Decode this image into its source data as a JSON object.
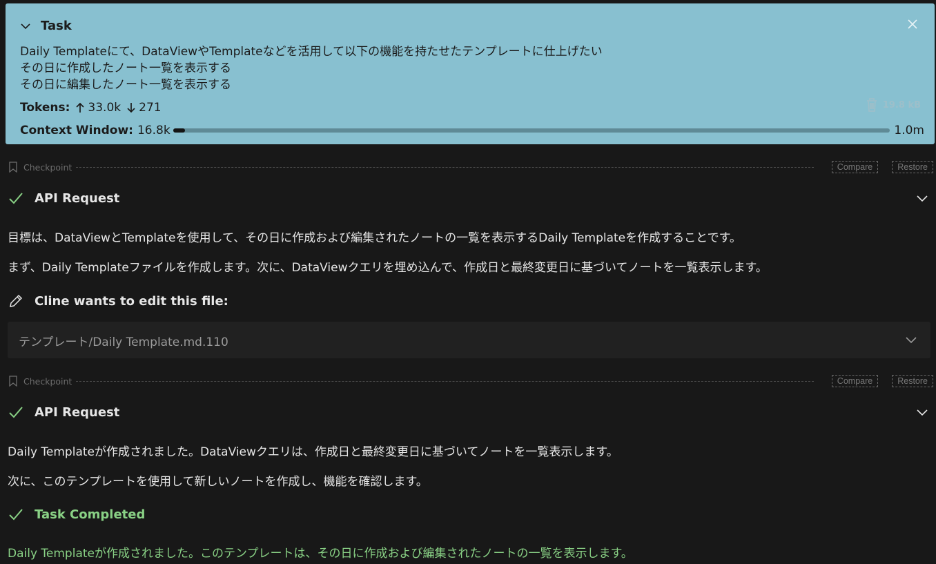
{
  "task": {
    "title": "Task",
    "lines": [
      "Daily Templateにて、DataViewやTemplateなどを活用して以下の機能を持たせたテンプレートに仕上げたい",
      "その日に作成したノート一覧を表示する",
      "その日に編集したノート一覧を表示する"
    ],
    "tokens_label": "Tokens:",
    "tokens_in": "33.0k",
    "tokens_out": "271",
    "size": "19.8 kB",
    "context_label": "Context Window:",
    "context_used": "16.8k",
    "context_max": "1.0m",
    "context_fraction": 0.0168
  },
  "checkpoint": {
    "label": "Checkpoint",
    "compare": "Compare",
    "restore": "Restore"
  },
  "api_request_1": {
    "title": "API Request",
    "text1": "目標は、DataViewとTemplateを使用して、その日に作成および編集されたノートの一覧を表示するDaily Templateを作成することです。",
    "text2": "まず、Daily Templateファイルを作成します。次に、DataViewクエリを埋め込んで、作成日と最終変更日に基づいてノートを一覧表示します。"
  },
  "edit": {
    "title": "Cline wants to edit this file:",
    "file_path": "テンプレート/Daily Template.md.110"
  },
  "api_request_2": {
    "title": "API Request",
    "text1": "Daily Templateが作成されました。DataViewクエリは、作成日と最終変更日に基づいてノートを一覧表示します。",
    "text2": "次に、このテンプレートを使用して新しいノートを作成し、機能を確認します。"
  },
  "completed": {
    "title": "Task Completed",
    "text": "Daily Templateが作成されました。このテンプレートは、その日に作成および編集されたノートの一覧を表示します。"
  },
  "colors": {
    "task_bg": "#88c0d0",
    "success": "#89d185",
    "bg": "#181818"
  }
}
